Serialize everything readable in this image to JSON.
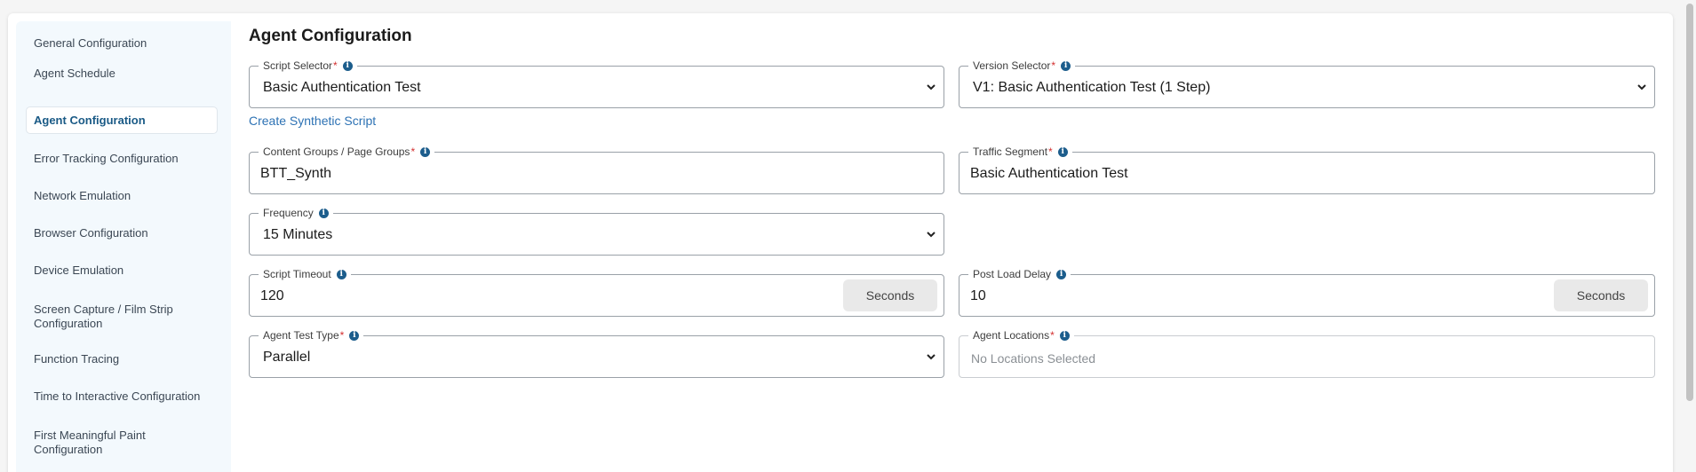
{
  "sidebar": {
    "items": [
      {
        "label": "General Configuration"
      },
      {
        "label": "Agent Schedule"
      },
      {
        "label": "Agent Configuration"
      },
      {
        "label": "Error Tracking Configuration"
      },
      {
        "label": "Network Emulation"
      },
      {
        "label": "Browser Configuration"
      },
      {
        "label": "Device Emulation"
      },
      {
        "label": "Screen Capture / Film Strip Configuration"
      },
      {
        "label": "Function Tracing"
      },
      {
        "label": "Time to Interactive Configuration"
      },
      {
        "label": "First Meaningful Paint Configuration"
      }
    ],
    "active_index": 2
  },
  "main": {
    "title": "Agent Configuration",
    "create_link": "Create Synthetic Script",
    "fields": {
      "script_selector": {
        "label": "Script Selector",
        "required": "*",
        "value": "Basic Authentication Test"
      },
      "version_selector": {
        "label": "Version Selector",
        "required": "*",
        "value": "V1: Basic Authentication Test (1 Step)"
      },
      "content_groups": {
        "label": "Content Groups / Page Groups",
        "required": "*",
        "value": "BTT_Synth"
      },
      "traffic_segment": {
        "label": "Traffic Segment",
        "required": "*",
        "value": "Basic Authentication Test"
      },
      "frequency": {
        "label": "Frequency",
        "value": "15 Minutes"
      },
      "script_timeout": {
        "label": "Script Timeout",
        "value": "120",
        "unit": "Seconds"
      },
      "post_load_delay": {
        "label": "Post Load Delay",
        "value": "10",
        "unit": "Seconds"
      },
      "agent_test_type": {
        "label": "Agent Test Type",
        "required": "*",
        "value": "Parallel"
      },
      "agent_locations": {
        "label": "Agent Locations",
        "required": "*",
        "placeholder": "No Locations Selected"
      }
    }
  },
  "icons": {
    "info": "info-icon",
    "chevron": "chevron-down-icon"
  },
  "colors": {
    "accent": "#1c5d8c",
    "link": "#2d72b4",
    "required": "#d32f2f",
    "sidebar_bg": "#f3f9fd"
  }
}
